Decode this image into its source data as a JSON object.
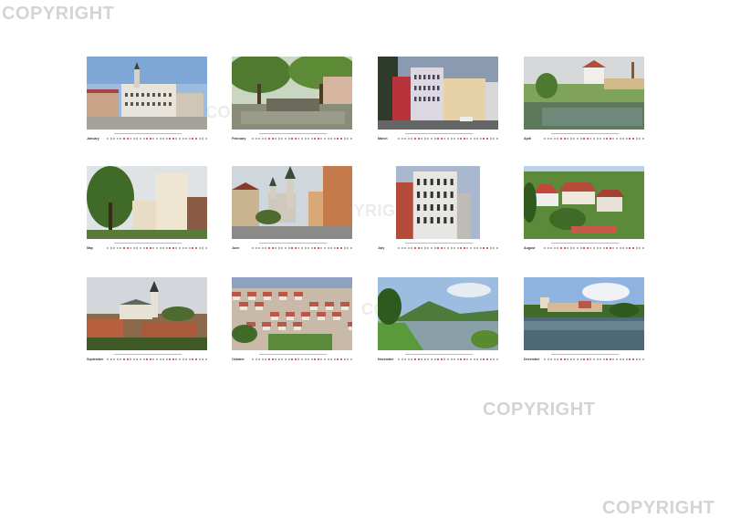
{
  "watermark": {
    "text": "COPYRIGHT",
    "color": "#d4d4d4"
  },
  "pages": [
    {
      "month": "January",
      "scene": "square"
    },
    {
      "month": "February",
      "scene": "fountain"
    },
    {
      "month": "March",
      "scene": "facades"
    },
    {
      "month": "April",
      "scene": "tower-pond"
    },
    {
      "month": "May",
      "scene": "white-building"
    },
    {
      "month": "June",
      "scene": "church-street"
    },
    {
      "month": "July",
      "scene": "corner-building"
    },
    {
      "month": "August",
      "scene": "rooftops-red"
    },
    {
      "month": "September",
      "scene": "cathedral"
    },
    {
      "month": "October",
      "scene": "panorama"
    },
    {
      "month": "November",
      "scene": "river-hill"
    },
    {
      "month": "December",
      "scene": "river-town"
    }
  ]
}
